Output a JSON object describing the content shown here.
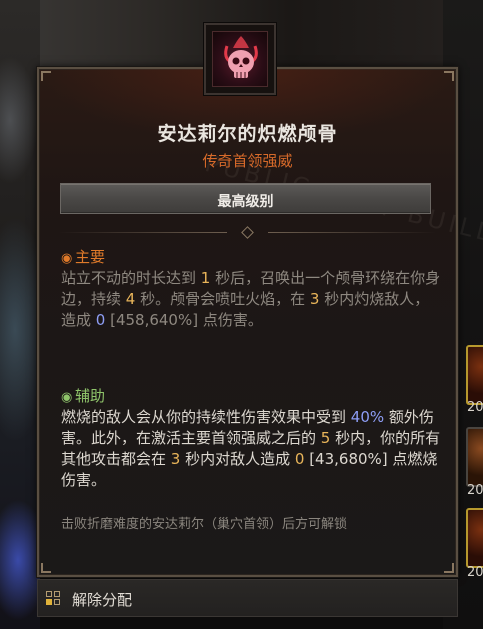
{
  "tooltip": {
    "watermark": "PUBLIC TEST BUILD",
    "title": "安达莉尔的炽燃颅骨",
    "subtitle": "传奇首领强威",
    "rank_label": "最高级别",
    "main": {
      "heading": "主要",
      "icon": "eye-icon",
      "text": [
        {
          "t": "站立不动的时长达到 "
        },
        {
          "t": "1",
          "c": "num-y"
        },
        {
          "t": " 秒后，召唤出一个颅骨环绕在你身边，持续 "
        },
        {
          "t": "4",
          "c": "num-y"
        },
        {
          "t": " 秒。颅骨会喷吐火焰，在 "
        },
        {
          "t": "3",
          "c": "num-y"
        },
        {
          "t": " 秒内灼烧敌人，造成 "
        },
        {
          "t": "0",
          "c": "num-b"
        },
        {
          "t": " [458,640%] 点伤害。"
        }
      ]
    },
    "assist": {
      "heading": "辅助",
      "icon": "eye-icon",
      "text": [
        {
          "t": "燃烧的敌人会从你的持续性伤害效果中受到 "
        },
        {
          "t": "40%",
          "c": "num-b"
        },
        {
          "t": " 额外伤害。此外，在激活主要首领强威之后的 "
        },
        {
          "t": "5",
          "c": "num-y"
        },
        {
          "t": " 秒内，你的所有其他攻击都会在 "
        },
        {
          "t": "3",
          "c": "num-y"
        },
        {
          "t": " 秒内对敌人造成 "
        },
        {
          "t": "0",
          "c": "num-y"
        },
        {
          "t": " [43,680%] 点燃烧伤害。"
        }
      ]
    },
    "unlock_note": "击败折磨难度的安达莉尔（巢穴首领）后方可解锁"
  },
  "action_bar": {
    "key_icon": "keyboard-key-icon",
    "label": "解除分配"
  },
  "slots": [
    {
      "number": "20"
    },
    {
      "number": "20"
    },
    {
      "number": "20"
    }
  ],
  "colors": {
    "title": "#eae6e0",
    "legendary": "#d76a2a",
    "main_head": "#e07a2a",
    "assist_head": "#8fc46a",
    "number_yellow": "#e9b55a",
    "number_blue": "#8e9ef5"
  }
}
